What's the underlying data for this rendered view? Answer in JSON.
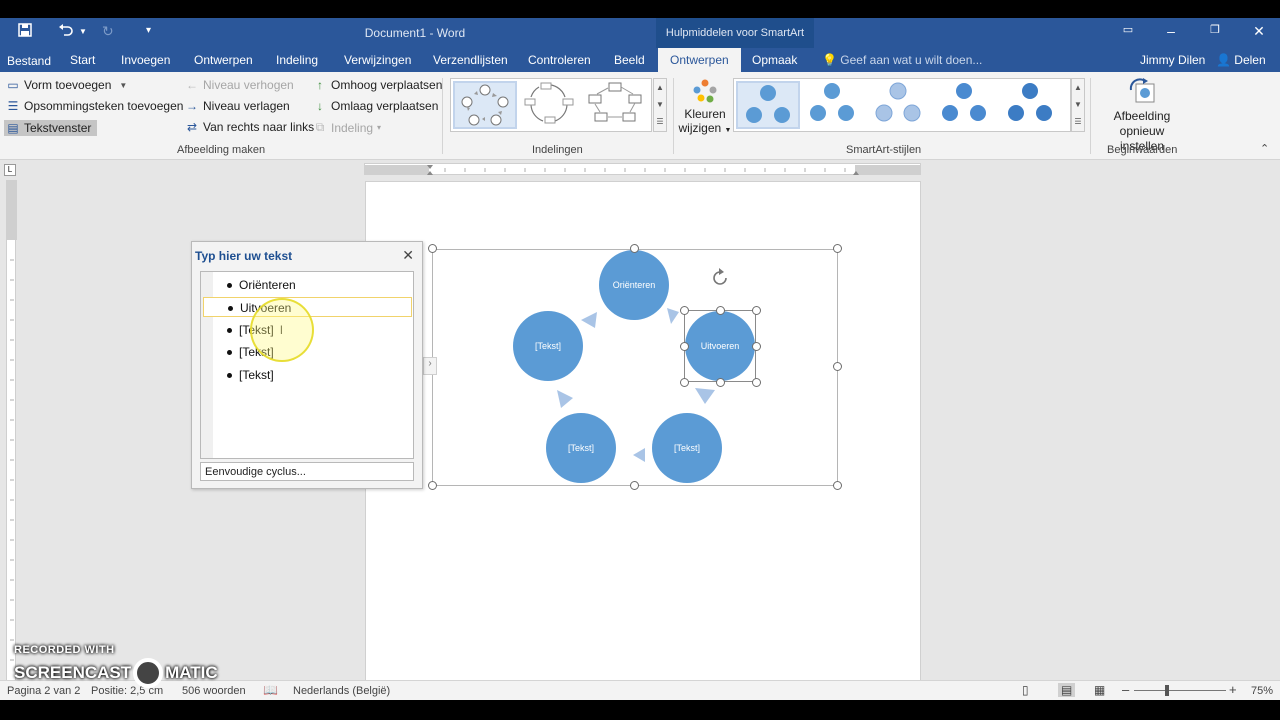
{
  "title_bar": {
    "document_title": "Document1 - Word",
    "context_title": "Hulpmiddelen voor SmartArt",
    "save_icon": "save-icon",
    "undo_icon": "undo-icon",
    "redo_icon": "redo-icon",
    "customize_icon": "customize-qat-icon"
  },
  "tabs": {
    "file": "Bestand",
    "items": [
      "Start",
      "Invoegen",
      "Ontwerpen",
      "Indeling",
      "Verwijzingen",
      "Verzendlijsten",
      "Controleren",
      "Beeld",
      "Ontwerpen",
      "Opmaak"
    ],
    "active_index": 8,
    "tell_me": "Geef aan wat u wilt doen...",
    "user": "Jimmy Dilen",
    "share": "Delen"
  },
  "ribbon": {
    "create_graphic": {
      "add_shape": "Vorm toevoegen",
      "add_bullet": "Opsommingsteken toevoegen",
      "text_pane": "Tekstvenster",
      "promote": "Niveau verhogen",
      "demote": "Niveau verlagen",
      "right_to_left": "Van rechts naar links",
      "move_up": "Omhoog verplaatsen",
      "move_down": "Omlaag verplaatsen",
      "layout": "Indeling",
      "label": "Afbeelding maken"
    },
    "layouts_label": "Indelingen",
    "change_colors_1": "Kleuren",
    "change_colors_2": "wijzigen",
    "styles_label": "SmartArt-stijlen",
    "reset_1": "Afbeelding",
    "reset_2": "opnieuw instellen",
    "reset_label": "Beginwaarden"
  },
  "text_pane": {
    "title": "Typ hier uw tekst",
    "items": [
      "Oriënteren",
      "Uitvoeren",
      "[Tekst]",
      "[Tekst]",
      "[Tekst]"
    ],
    "highlighted_index": 1,
    "footer": "Eenvoudige cyclus..."
  },
  "smartart": {
    "nodes": [
      "Oriënteren",
      "Uitvoeren",
      "[Tekst]",
      "[Tekst]",
      "[Tekst]"
    ],
    "node_color": "#5b9bd5",
    "arrow_color": "#a9c4e6"
  },
  "status_bar": {
    "page": "Pagina 2 van 2",
    "position": "Positie: 2,5 cm",
    "words": "506 woorden",
    "language": "Nederlands (België)",
    "zoom": "75%"
  },
  "watermark": {
    "line1": "RECORDED WITH",
    "line2a": "SCREENCAST",
    "line2b": "MATIC"
  }
}
